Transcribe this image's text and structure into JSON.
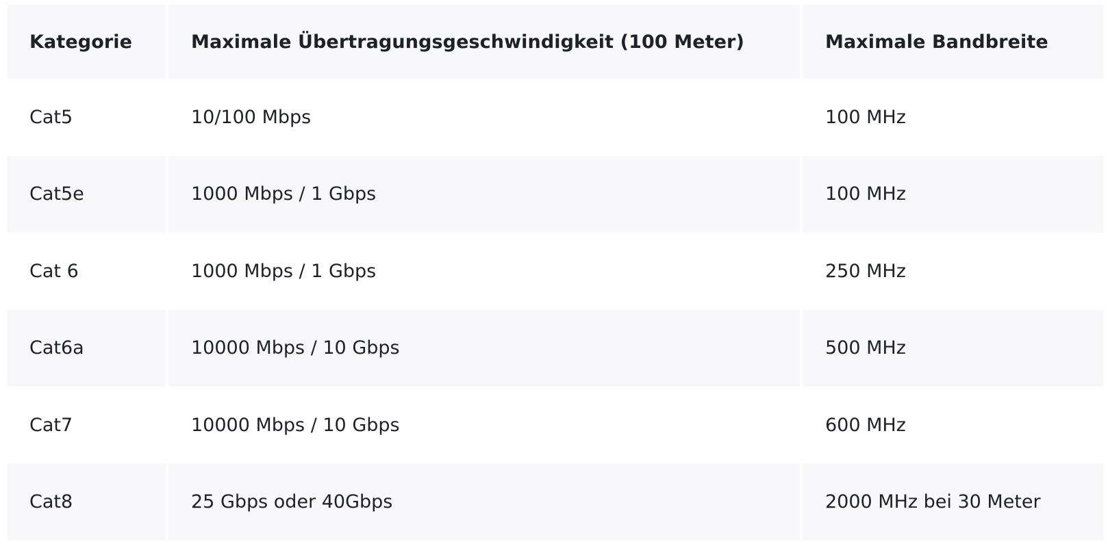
{
  "table": {
    "headers": [
      "Kategorie",
      "Maximale Übertragungsgeschwindigkeit (100 Meter)",
      "Maximale Bandbreite"
    ],
    "rows": [
      [
        "Cat5",
        "10/100 Mbps",
        "100 MHz"
      ],
      [
        "Cat5e",
        "1000 Mbps / 1 Gbps",
        "100 MHz"
      ],
      [
        "Cat 6",
        "1000 Mbps / 1 Gbps",
        "250 MHz"
      ],
      [
        "Cat6a",
        "10000 Mbps / 10 Gbps",
        "500 MHz"
      ],
      [
        "Cat7",
        "10000 Mbps / 10 Gbps",
        "600 MHz"
      ],
      [
        "Cat8",
        "25 Gbps oder 40Gbps",
        "2000 MHz bei 30 Meter"
      ]
    ]
  },
  "colors": {
    "shaded_row": "#f8f8fa",
    "text": "#1f2128"
  }
}
